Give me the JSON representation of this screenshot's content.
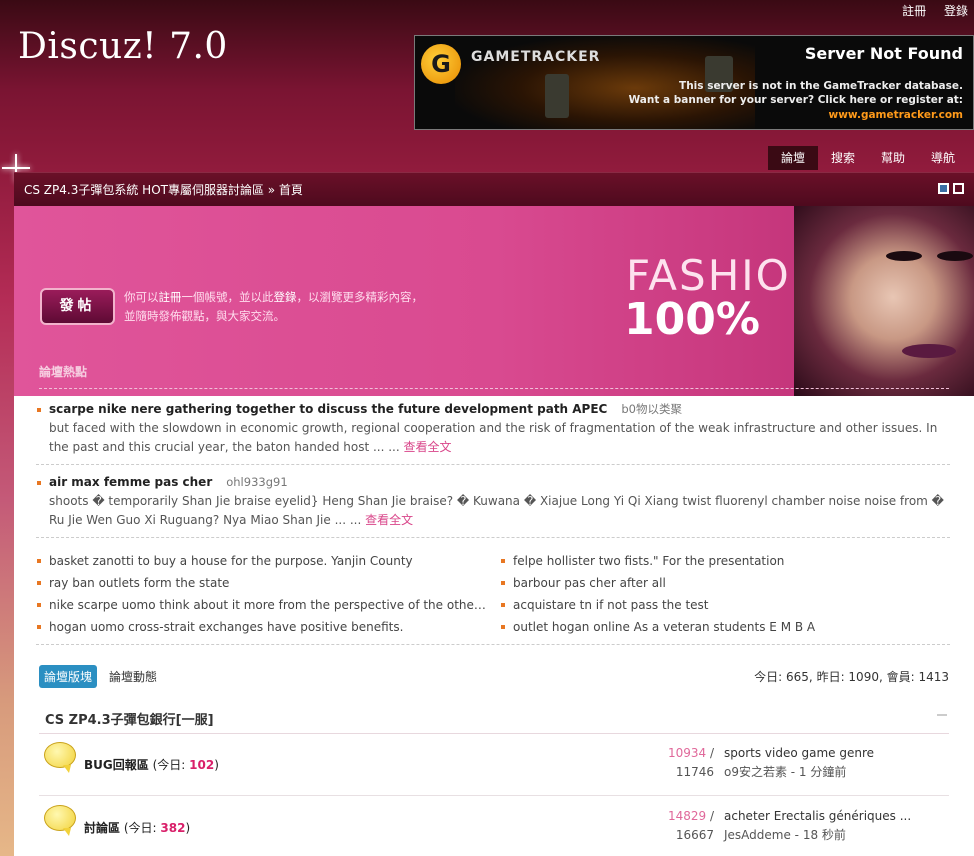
{
  "header": {
    "toplinks": [
      "註冊",
      "登錄"
    ],
    "logo": "Discuz! 7.0",
    "banner": {
      "brand": "GAMETRACKER",
      "logo_letter": "G",
      "title": "Server Not Found",
      "line1": "This server is not in the GameTracker database.",
      "line2": "Want a banner for your server?  Click here or register at:",
      "url": "www.gametracker.com"
    },
    "nav": [
      "論壇",
      "搜索",
      "幫助",
      "導航"
    ]
  },
  "breadcrumb": "CS ZP4.3子彈包系統 HOT專屬伺服器討論區 » 首頁",
  "hero": {
    "post_button": "發帖",
    "welcome_pre": "你可以",
    "welcome_register": "註冊",
    "welcome_mid": "一個帳號，並以此",
    "welcome_login": "登錄",
    "welcome_post": "，以瀏覽更多精彩內容，並隨時發佈觀點，與大家交流。",
    "fashion": "FASHION",
    "percent": "100%",
    "hot_title": "論壇熱點"
  },
  "hot_items": [
    {
      "title": "scarpe nike nere gathering together to discuss the future development path APEC",
      "author": "b0物以类聚",
      "body": "but faced with the slowdown in economic growth, regional cooperation and the risk of fragmentation of the weak infrastructure and other issues. In the past and this crucial year, the baton handed host ... ...",
      "more": "查看全文"
    },
    {
      "title": "air max femme pas cher",
      "author": "ohl933g91",
      "body": "shoots � temporarily Shan Jie braise eyelid} Heng Shan Jie braise? � Kuwana � Xiajue Long Yi Qi Xiang twist fluorenyl chamber noise noise from � Ru Jie Wen Guo Xi Ruguang? Nya Miao Shan Jie ... ...",
      "more": "查看全文"
    }
  ],
  "hot_list": [
    "basket zanotti to buy a house for the purpose. Yanjin County",
    "felpe hollister two fists.\" For the presentation",
    "ray ban outlets form the state",
    "barbour pas cher after all",
    "nike scarpe uomo think about it more from the perspective of the other side",
    "acquistare tn if not pass the test",
    "hogan uomo cross-strait exchanges have positive benefits.",
    "outlet hogan online As a veteran students E M B A"
  ],
  "tabs": [
    "論壇版塊",
    "論壇動態"
  ],
  "stats": "今日: 665, 昨日: 1090, 會員: 1413",
  "group_title": "CS ZP4.3子彈包銀行[一服]",
  "forums": [
    {
      "name": "BUG回報區",
      "today_label": "(今日: ",
      "today": "102",
      "today_close": ")",
      "threads": "10934",
      "sep": "/",
      "posts": "11746",
      "last_title": "sports video game genre",
      "last_by": "o9安之若素 - 1 分鐘前"
    },
    {
      "name": "討論區",
      "today_label": "(今日: ",
      "today": "382",
      "today_close": ")",
      "threads": "14829",
      "sep": "/",
      "posts": "16667",
      "last_title": "acheter Erectalis génériques ...",
      "last_by": "JesAddeme - 18 秒前"
    }
  ],
  "colors": {
    "accent_pink": "#d9468a",
    "tab_blue": "#2b8fc2",
    "bullet_orange": "#e87722",
    "today_red": "#d9206a"
  }
}
